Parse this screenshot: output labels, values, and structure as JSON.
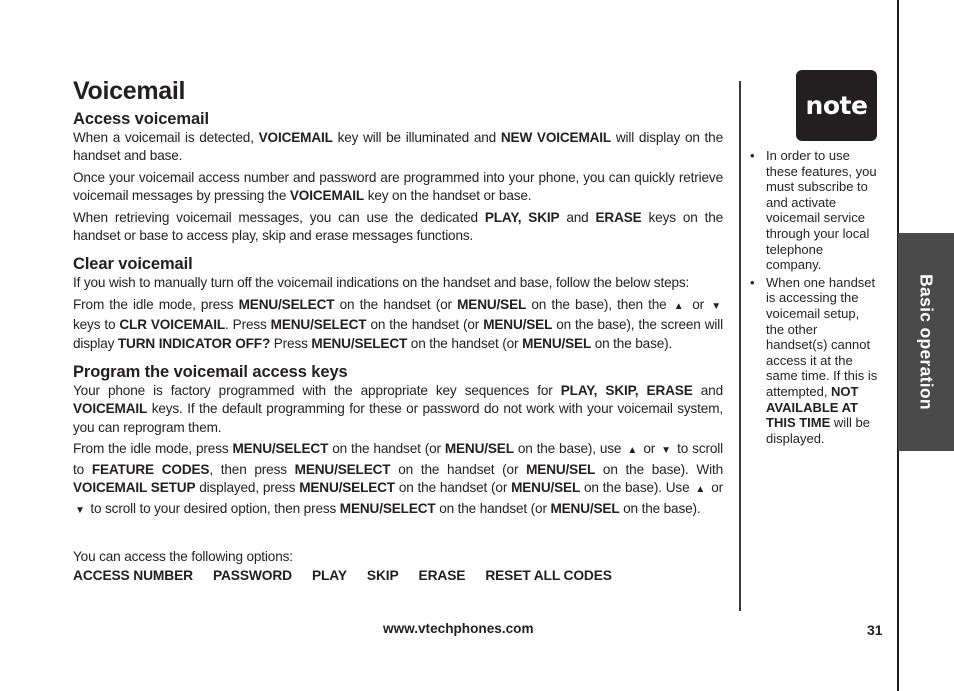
{
  "page": {
    "title": "Voicemail",
    "footer_url": "www.vtechphones.com",
    "page_number": "31",
    "side_tab": "Basic operation"
  },
  "sections": [
    {
      "heading": "Access voicemail",
      "paragraphs": [
        [
          {
            "t": "When a voicemail is detected, "
          },
          {
            "b": "VOICEMAIL"
          },
          {
            "t": " key will be illuminated and "
          },
          {
            "b": "NEW VOICEMAIL"
          },
          {
            "t": " will display on the handset and base."
          }
        ],
        [
          {
            "t": "Once your voicemail access number and password are programmed into your phone, you can quickly retrieve voicemail messages by pressing the "
          },
          {
            "b": "VOICEMAIL"
          },
          {
            "t": " key on the handset or base."
          }
        ],
        [
          {
            "t": "When retrieving voicemail messages, you can use the dedicated "
          },
          {
            "b": "PLAY, SKIP"
          },
          {
            "t": " and "
          },
          {
            "b": "ERASE"
          },
          {
            "t": " keys on the handset or base to access play, skip and erase messages functions."
          }
        ]
      ]
    },
    {
      "heading": "Clear voicemail",
      "paragraphs": [
        [
          {
            "t": "If you wish to manually turn off the voicemail indications on the handset and base, follow the below steps:"
          }
        ],
        [
          {
            "t": "From the idle mode, press "
          },
          {
            "b": "MENU/SELECT"
          },
          {
            "t": " on the handset (or "
          },
          {
            "b": "MENU/SEL"
          },
          {
            "t": " on the base), then the "
          },
          {
            "a": "up"
          },
          {
            "t": " or "
          },
          {
            "a": "down"
          },
          {
            "t": " keys to "
          },
          {
            "b": "CLR VOICEMAIL"
          },
          {
            "t": ". Press "
          },
          {
            "b": "MENU/SELECT"
          },
          {
            "t": " on the handset (or "
          },
          {
            "b": "MENU/SEL"
          },
          {
            "t": " on the base), the screen will display "
          },
          {
            "b": "TURN INDICATOR OFF?"
          },
          {
            "t": " Press "
          },
          {
            "b": "MENU/SELECT"
          },
          {
            "t": " on the handset (or "
          },
          {
            "b": "MENU/SEL"
          },
          {
            "t": " on the base)."
          }
        ]
      ]
    },
    {
      "heading": "Program the voicemail access keys",
      "paragraphs": [
        [
          {
            "t": "Your phone is factory programmed with the appropriate key sequences for "
          },
          {
            "b": "PLAY, SKIP, ERASE"
          },
          {
            "t": " and "
          },
          {
            "b": "VOICEMAIL"
          },
          {
            "t": " keys. If the default programming for these or password do not work with your voicemail system, you can reprogram them."
          }
        ],
        [
          {
            "t": "From the idle mode, press "
          },
          {
            "b": "MENU/SELECT"
          },
          {
            "t": " on the handset (or "
          },
          {
            "b": "MENU/SEL"
          },
          {
            "t": " on the base), use "
          },
          {
            "a": "up"
          },
          {
            "t": " or "
          },
          {
            "a": "down"
          },
          {
            "t": " to scroll to "
          },
          {
            "b": "FEATURE CODES"
          },
          {
            "t": ", then press "
          },
          {
            "b": "MENU/SELECT"
          },
          {
            "t": " on the handset (or "
          },
          {
            "b": "MENU/SEL"
          },
          {
            "t": " on the base). With "
          },
          {
            "b": "VOICEMAIL SETUP"
          },
          {
            "t": " displayed, press "
          },
          {
            "b": "MENU/SELECT"
          },
          {
            "t": " on the handset (or "
          },
          {
            "b": "MENU/SEL"
          },
          {
            "t": " on the base). Use "
          },
          {
            "a": "up"
          },
          {
            "t": " or "
          },
          {
            "a": "down"
          },
          {
            "t": " to scroll to your desired option, then press "
          },
          {
            "b": "MENU/SELECT"
          },
          {
            "t": " on the handset (or "
          },
          {
            "b": "MENU/SEL"
          },
          {
            "t": " on the base)."
          }
        ]
      ]
    }
  ],
  "options_intro": "You can access the following options:",
  "options": [
    "ACCESS NUMBER",
    "PASSWORD",
    "PLAY",
    "SKIP",
    "ERASE",
    "RESET ALL CODES"
  ],
  "note": {
    "badge": "note",
    "items": [
      [
        {
          "t": "In order to use these features, you must subscribe to and activate voicemail service through your local telephone company."
        }
      ],
      [
        {
          "t": "When one handset is accessing the voicemail setup, the other handset(s) cannot access it at the same time. If this is attempted, "
        },
        {
          "b": "NOT AVAILABLE AT THIS TIME"
        },
        {
          "t": " will be displayed."
        }
      ]
    ]
  },
  "icons": {
    "up": "▲",
    "down": "▼"
  },
  "colors": {
    "text": "#231f20",
    "tab_background": "#4b4a4a",
    "note_badge": "#231f20"
  }
}
